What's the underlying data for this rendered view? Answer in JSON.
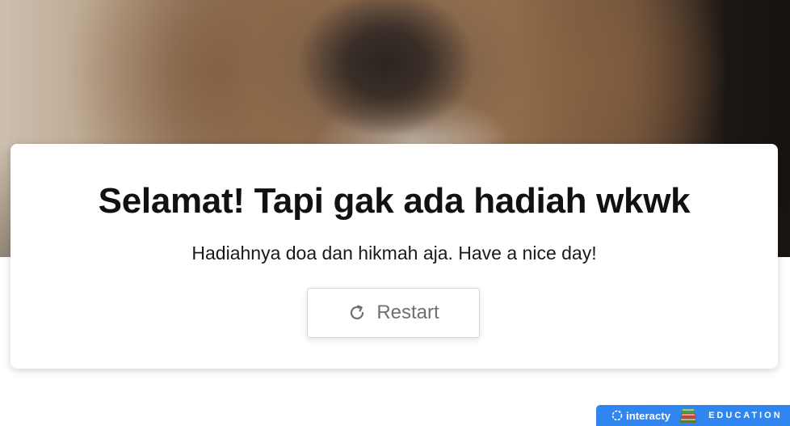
{
  "result": {
    "title": "Selamat! Tapi gak ada hadiah wkwk",
    "subtitle": "Hadiahnya doa dan hikmah aja. Have a nice day!",
    "restart_label": "Restart",
    "restart_icon": "restart-icon"
  },
  "badge": {
    "brand": "interacty",
    "category": "EDUCATION",
    "color": "#2f86f0"
  }
}
